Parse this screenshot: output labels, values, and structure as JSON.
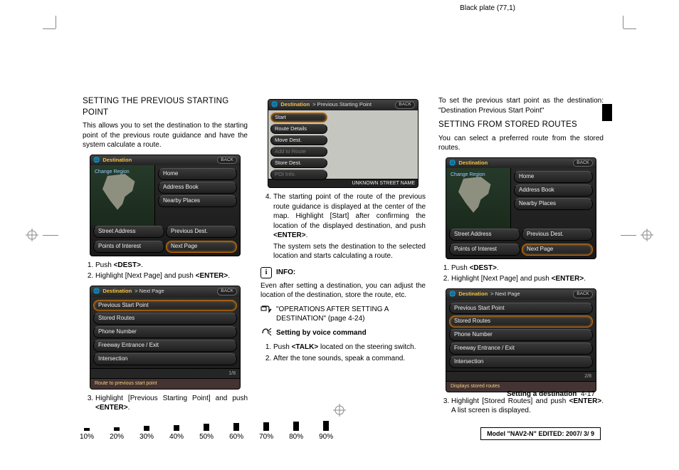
{
  "meta": {
    "black_plate": "Black plate (77,1)",
    "section_footer_label": "Setting a destination",
    "section_footer_page": "4-17",
    "model_line_prefix": "Model \"",
    "model_name": "NAV2-N",
    "model_line_mid": "\" EDITED:  ",
    "model_date": "2007/ 3/ 9"
  },
  "density": [
    "10%",
    "20%",
    "30%",
    "40%",
    "50%",
    "60%",
    "70%",
    "80%",
    "90%"
  ],
  "col1": {
    "heading": "SETTING THE PREVIOUS STARTING POINT",
    "intro": "This allows you to set the destination to the starting point of the previous route guidance and have the system calculate a route.",
    "screen1": {
      "title": "Destination",
      "back": "BACK",
      "map_label": "Change Region",
      "right": [
        "Home",
        "Address Book",
        "Nearby Places"
      ],
      "lower_left": [
        "Street Address",
        "Points of Interest"
      ],
      "lower_right": [
        "Previous Dest.",
        "Next Page"
      ]
    },
    "step1": "Push ",
    "step1_bold": "<DEST>",
    "step1_end": ".",
    "step2": "Highlight [Next Page] and push ",
    "step2_bold": "<ENTER>",
    "step2_end": ".",
    "screen2": {
      "title": "Destination",
      "crumb": "> Next Page",
      "back": "BACK",
      "items": [
        "Previous Start Point",
        "Stored Routes",
        "Phone Number",
        "Freeway Entrance / Exit",
        "Intersection"
      ],
      "pager": "1/8",
      "footer": "Route to previous start point"
    },
    "step3a": "Highlight [Previous Starting Point] and push ",
    "step3_bold": "<ENTER>",
    "step3b": "."
  },
  "col2": {
    "screen3": {
      "title": "Destination",
      "crumb": "> Previous Starting Point",
      "back": "BACK",
      "items": [
        "Start",
        "Route Details",
        "Move Dest.",
        "Add to Route",
        "Store Dest.",
        "POI Info."
      ],
      "caption": "UNKNOWN STREET NAME"
    },
    "step4a": "The starting point of the route of the previous route guidance is displayed at the center of the map. Highlight [Start] after confirming the location of the displayed destination, and push ",
    "step4_bold": "<ENTER>",
    "step4b": ".",
    "step4_cont": "The system sets the destination to the selected location and starts calculating a route.",
    "info_label": "INFO:",
    "info_text": "Even after setting a destination, you can adjust the location of the destination, store the route, etc.",
    "ref_text": "\"OPERATIONS AFTER SETTING A DESTINATION\" (page 4-24)",
    "voice_label": "Setting by voice command",
    "vstep1a": "Push ",
    "vstep1_bold": "<TALK>",
    "vstep1b": " located on the steering switch.",
    "vstep2": "After the tone sounds, speak a command."
  },
  "col3": {
    "intro": "To set the previous start point as the destination: \"Destination Previous Start Point\"",
    "heading": "SETTING FROM STORED ROUTES",
    "body": "You can select a preferred route from the stored routes.",
    "screen4": {
      "title": "Destination",
      "back": "BACK",
      "map_label": "Change Region",
      "right": [
        "Home",
        "Address Book",
        "Nearby Places"
      ],
      "lower_left": [
        "Street Address",
        "Points of Interest"
      ],
      "lower_right": [
        "Previous Dest.",
        "Next Page"
      ]
    },
    "step1": "Push ",
    "step1_bold": "<DEST>",
    "step1_end": ".",
    "step2": "Highlight [Next Page] and push ",
    "step2_bold": "<ENTER>",
    "step2_end": ".",
    "screen5": {
      "title": "Destination",
      "crumb": "> Next Page",
      "back": "BACK",
      "items": [
        "Previous Start Point",
        "Stored Routes",
        "Phone Number",
        "Freeway Entrance / Exit",
        "Intersection"
      ],
      "pager": "2/8",
      "footer": "Displays stored routes"
    },
    "step3a": "Highlight [Stored Routes] and push ",
    "step3_bold": "<ENTER>",
    "step3b": ". A list screen is displayed."
  }
}
